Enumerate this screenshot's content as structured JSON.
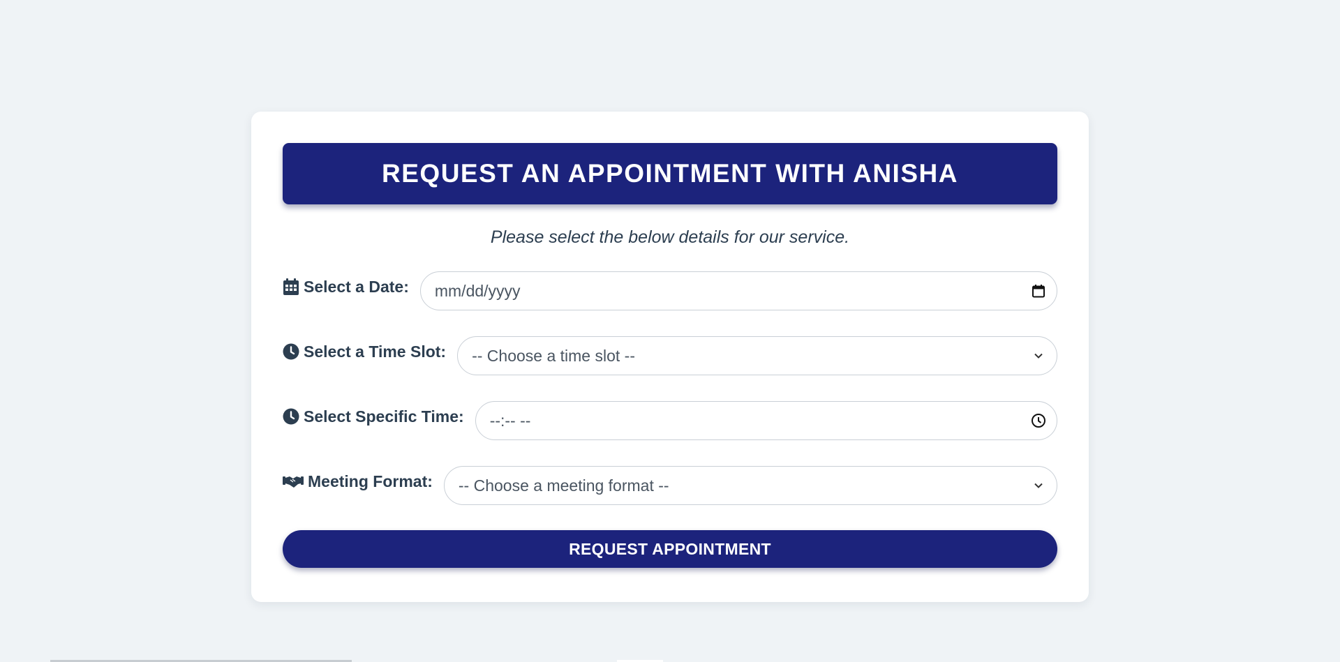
{
  "header": {
    "title": "REQUEST AN APPOINTMENT WITH ANISHA",
    "subtitle": "Please select the below details for our service."
  },
  "form": {
    "date": {
      "label": "Select a Date:",
      "value": "mm/dd/yyyy",
      "icon": "calendar-icon"
    },
    "time_slot": {
      "label": "Select a Time Slot:",
      "value": "-- Choose a time slot --",
      "icon": "clock-icon"
    },
    "specific_time": {
      "label": "Select Specific Time:",
      "value": "--:-- --",
      "icon": "clock-icon"
    },
    "meeting_format": {
      "label": "Meeting Format:",
      "value": "-- Choose a meeting format --",
      "icon": "handshake-icon"
    },
    "submit_label": "REQUEST APPOINTMENT"
  },
  "colors": {
    "primary": "#1c237c",
    "text": "#2c3e50",
    "background": "#eff3f6",
    "card": "#ffffff"
  }
}
